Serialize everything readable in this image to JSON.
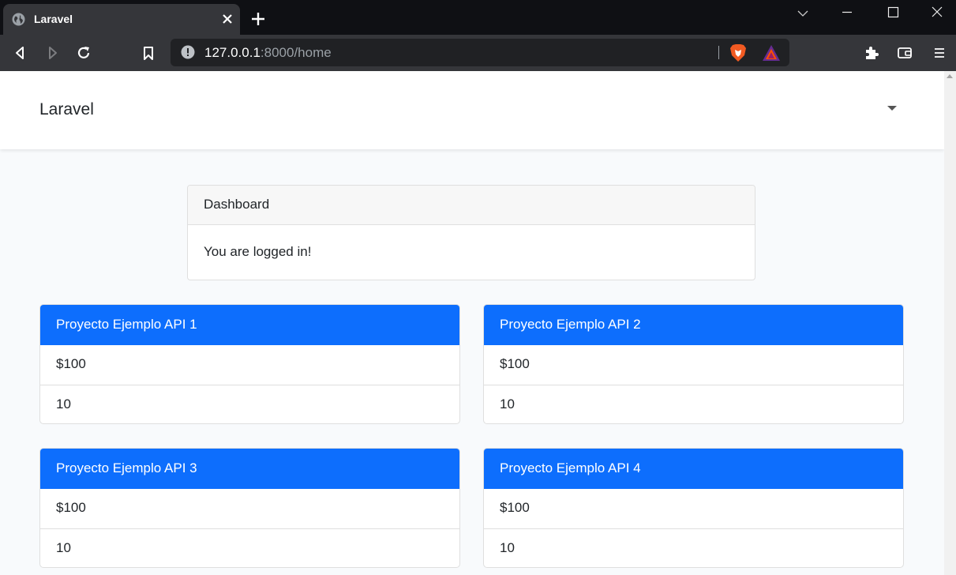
{
  "browser": {
    "tab_title": "Laravel",
    "url_host": "127.0.0.1",
    "url_rest": ":8000/home"
  },
  "navbar": {
    "brand": "Laravel"
  },
  "dashboard": {
    "header": "Dashboard",
    "message": "You are logged in!"
  },
  "projects": [
    {
      "name": "Proyecto Ejemplo API 1",
      "price": "$100",
      "quantity": "10"
    },
    {
      "name": "Proyecto Ejemplo API 2",
      "price": "$100",
      "quantity": "10"
    },
    {
      "name": "Proyecto Ejemplo API 3",
      "price": "$100",
      "quantity": "10"
    },
    {
      "name": "Proyecto Ejemplo API 4",
      "price": "$100",
      "quantity": "10"
    }
  ],
  "colors": {
    "primary": "#0d6efd",
    "titlebar": "#0f1014",
    "toolbar": "#35363a",
    "page_bg": "#f8fafc"
  },
  "icons": [
    "globe-icon",
    "close-icon",
    "plus-icon",
    "chevron-down-icon",
    "minimize-icon",
    "maximize-icon",
    "back-icon",
    "forward-icon",
    "reload-icon",
    "bookmark-icon",
    "info-icon",
    "brave-shield-icon",
    "bat-rewards-icon",
    "extensions-icon",
    "wallet-icon",
    "menu-icon",
    "caret-down-icon"
  ]
}
